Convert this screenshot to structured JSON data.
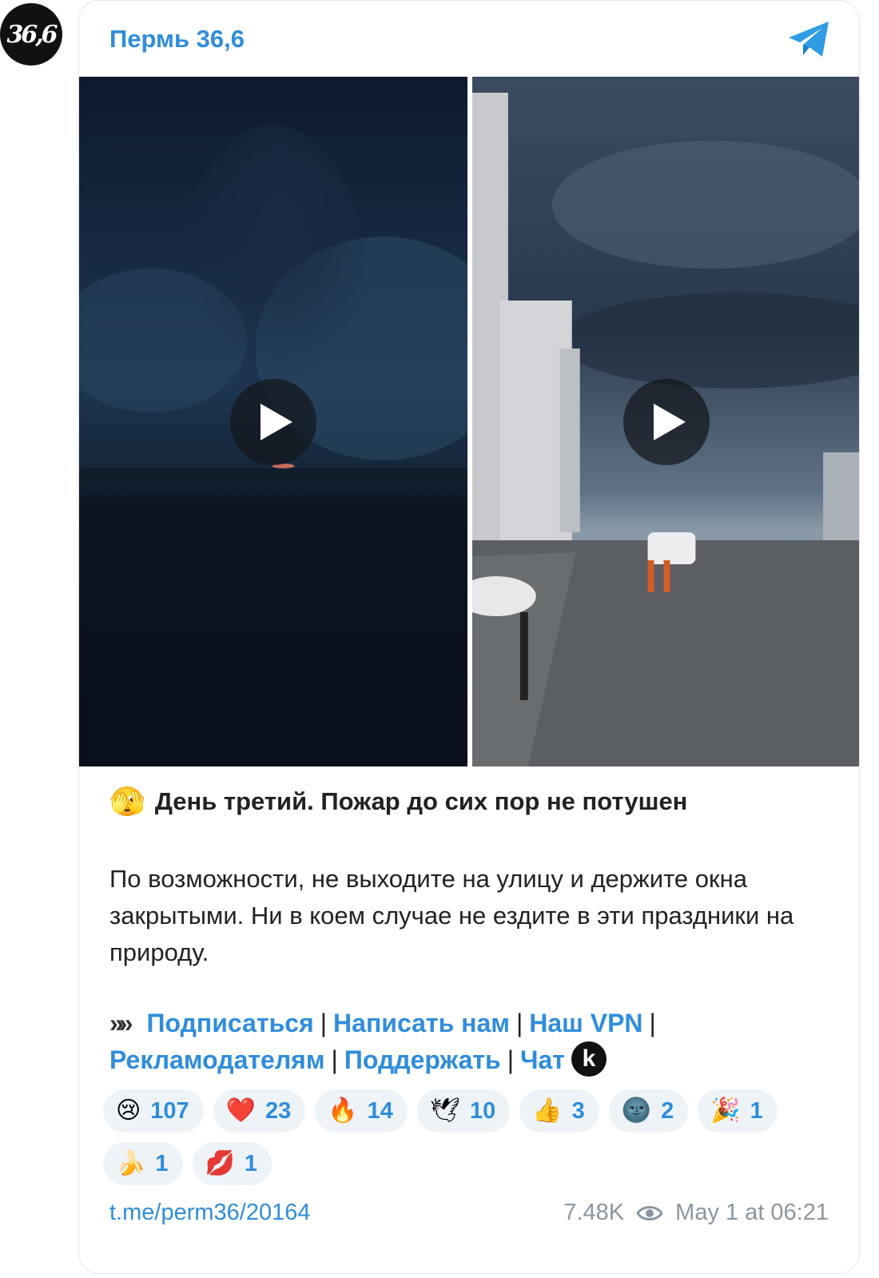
{
  "channel": {
    "avatar_text": "36,6",
    "name": "Пермь 36,6"
  },
  "post": {
    "title_emoji": "🫣",
    "title": "День третий. Пожар до сих пор не потушен",
    "body": "По возможности, не выходите на улицу и держите окна закрытыми. Ни в коем случае не ездите в эти праздники на природу.",
    "links_arrow": "»»",
    "links": [
      {
        "label": "Подписаться"
      },
      {
        "label": "Написать нам"
      },
      {
        "label": "Наш VPN"
      },
      {
        "label": "Рекламодателям"
      },
      {
        "label": "Поддержать"
      },
      {
        "label": "Чат"
      }
    ],
    "separator": "|",
    "k_badge": "k"
  },
  "reactions": [
    {
      "emoji": "😢",
      "count": "107"
    },
    {
      "emoji": "❤️",
      "count": "23"
    },
    {
      "emoji": "🔥",
      "count": "14"
    },
    {
      "emoji": "🕊",
      "count": "10"
    },
    {
      "emoji": "👍",
      "count": "3"
    },
    {
      "emoji": "🌚",
      "count": "2"
    },
    {
      "emoji": "🎉",
      "count": "1"
    },
    {
      "emoji": "🍌",
      "count": "1"
    },
    {
      "emoji": "💋",
      "count": "1"
    }
  ],
  "footer": {
    "link": "t.me/perm36/20164",
    "views": "7.48K",
    "date": "May 1 at 06:21"
  },
  "colors": {
    "accent": "#2f8ddb",
    "reaction_bg": "#eef3f8",
    "meta": "#8a96a3"
  },
  "icons": [
    "telegram-icon",
    "play-icon",
    "eye-icon"
  ]
}
